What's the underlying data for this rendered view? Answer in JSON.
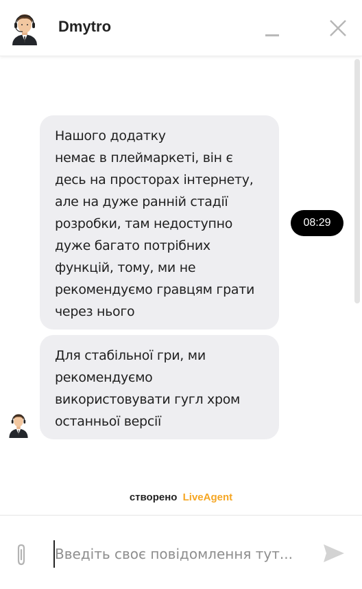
{
  "header": {
    "agent_name": "Dmytro",
    "avatar_icon": "agent-avatar",
    "minimize_icon": "minimize-icon",
    "close_icon": "close-icon"
  },
  "messages": [
    {
      "lines": [
        "Нашого додатку",
        "немає в плеймаркеті, він є",
        "десь на просторах інтернету,",
        "але на дуже ранній стадії",
        "розробки, там недоступно",
        "дуже багато потрібних",
        "функцій, тому, ми не",
        "рекомендуємо гравцям грати",
        "через нього"
      ],
      "time": "08:29"
    },
    {
      "lines": [
        "Для стабільної гри, ми",
        "рекомендуємо",
        "використовувати гугл хром",
        "останньої версії"
      ]
    }
  ],
  "footer": {
    "powered_prefix": "створено",
    "powered_brand": "LiveAgent",
    "brand_color": "#f5a623"
  },
  "composer": {
    "placeholder": "Введіть своє повідомлення тут...",
    "value": "",
    "attach_icon": "paperclip-icon",
    "send_icon": "send-icon"
  }
}
